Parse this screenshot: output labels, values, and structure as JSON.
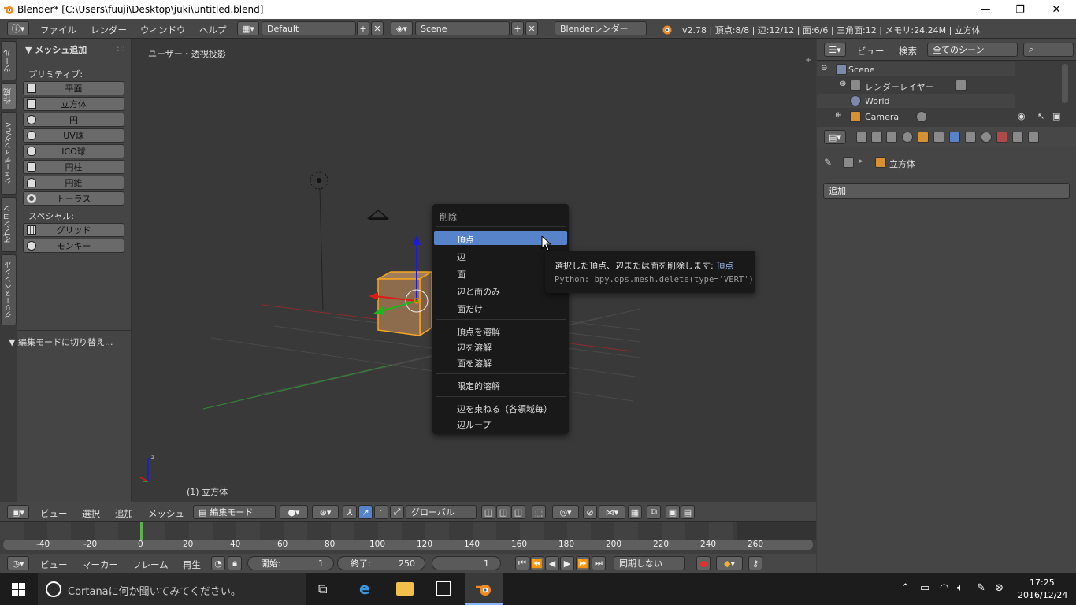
{
  "window": {
    "title": "Blender* [C:\\Users\\fuuji\\Desktop\\juki\\untitled.blend]",
    "controls": [
      "—",
      "❐",
      "✕"
    ]
  },
  "info_header": {
    "menus": [
      "ファイル",
      "レンダー",
      "ウィンドウ",
      "ヘルプ"
    ],
    "layout": "Default",
    "scene": "Scene",
    "engine": "Blenderレンダー",
    "stats": "v2.78 | 頂点:8/8 | 辺:12/12 | 面:6/6 | 三角面:12 | メモリ:24.24M | 立方体"
  },
  "tool_tabs": [
    "ツール",
    "作成",
    "シェーディング/UV",
    "オプション",
    "グリースペンシル"
  ],
  "tool_panel": {
    "header": "▼ メッシュ追加",
    "primitives_label": "プリミティブ:",
    "primitives": [
      "平面",
      "立方体",
      "円",
      "UV球",
      "ICO球",
      "円柱",
      "円錐",
      "トーラス"
    ],
    "special_label": "スペシャル:",
    "special": [
      "グリッド",
      "モンキー"
    ],
    "operator_header": "▼ 編集モードに切り替え..."
  },
  "viewport": {
    "label": "ユーザー・透視投影",
    "object_label": "(1) 立方体"
  },
  "delete_menu": {
    "title": "削除",
    "items": [
      "頂点",
      "辺",
      "面",
      "辺と面のみ",
      "面だけ",
      "頂点を溶解",
      "辺を溶解",
      "面を溶解",
      "限定的溶解",
      "辺を束ねる（各領域毎）",
      "辺ループ"
    ]
  },
  "tooltip": {
    "desc": "選択した頂点、辺または面を削除します:",
    "value": "頂点",
    "python": "Python: bpy.ops.mesh.delete(type='VERT')"
  },
  "outliner": {
    "menus": [
      "ビュー",
      "検索"
    ],
    "filter": "全てのシーン",
    "items": [
      "Scene",
      "レンダーレイヤー",
      "World",
      "Camera"
    ]
  },
  "properties": {
    "object": "立方体",
    "modifier_add": "追加"
  },
  "view3d_header": {
    "menus": [
      "ビュー",
      "選択",
      "追加",
      "メッシュ"
    ],
    "mode": "編集モード",
    "orientation": "グローバル"
  },
  "timeline": {
    "ticks": [
      "-40",
      "-20",
      "0",
      "20",
      "40",
      "60",
      "80",
      "100",
      "120",
      "140",
      "160",
      "180",
      "200",
      "220",
      "240",
      "260"
    ],
    "menus": [
      "ビュー",
      "マーカー",
      "フレーム",
      "再生"
    ],
    "start_label": "開始:",
    "start": "1",
    "end_label": "終了:",
    "end": "250",
    "current": "1",
    "sync": "同期しない"
  },
  "taskbar": {
    "search": "Cortanaに何か聞いてみてください。",
    "time": "17:25",
    "date": "2016/12/24"
  },
  "colors": {
    "highlight": "#5683c9",
    "object_orange": "#f5a623"
  }
}
